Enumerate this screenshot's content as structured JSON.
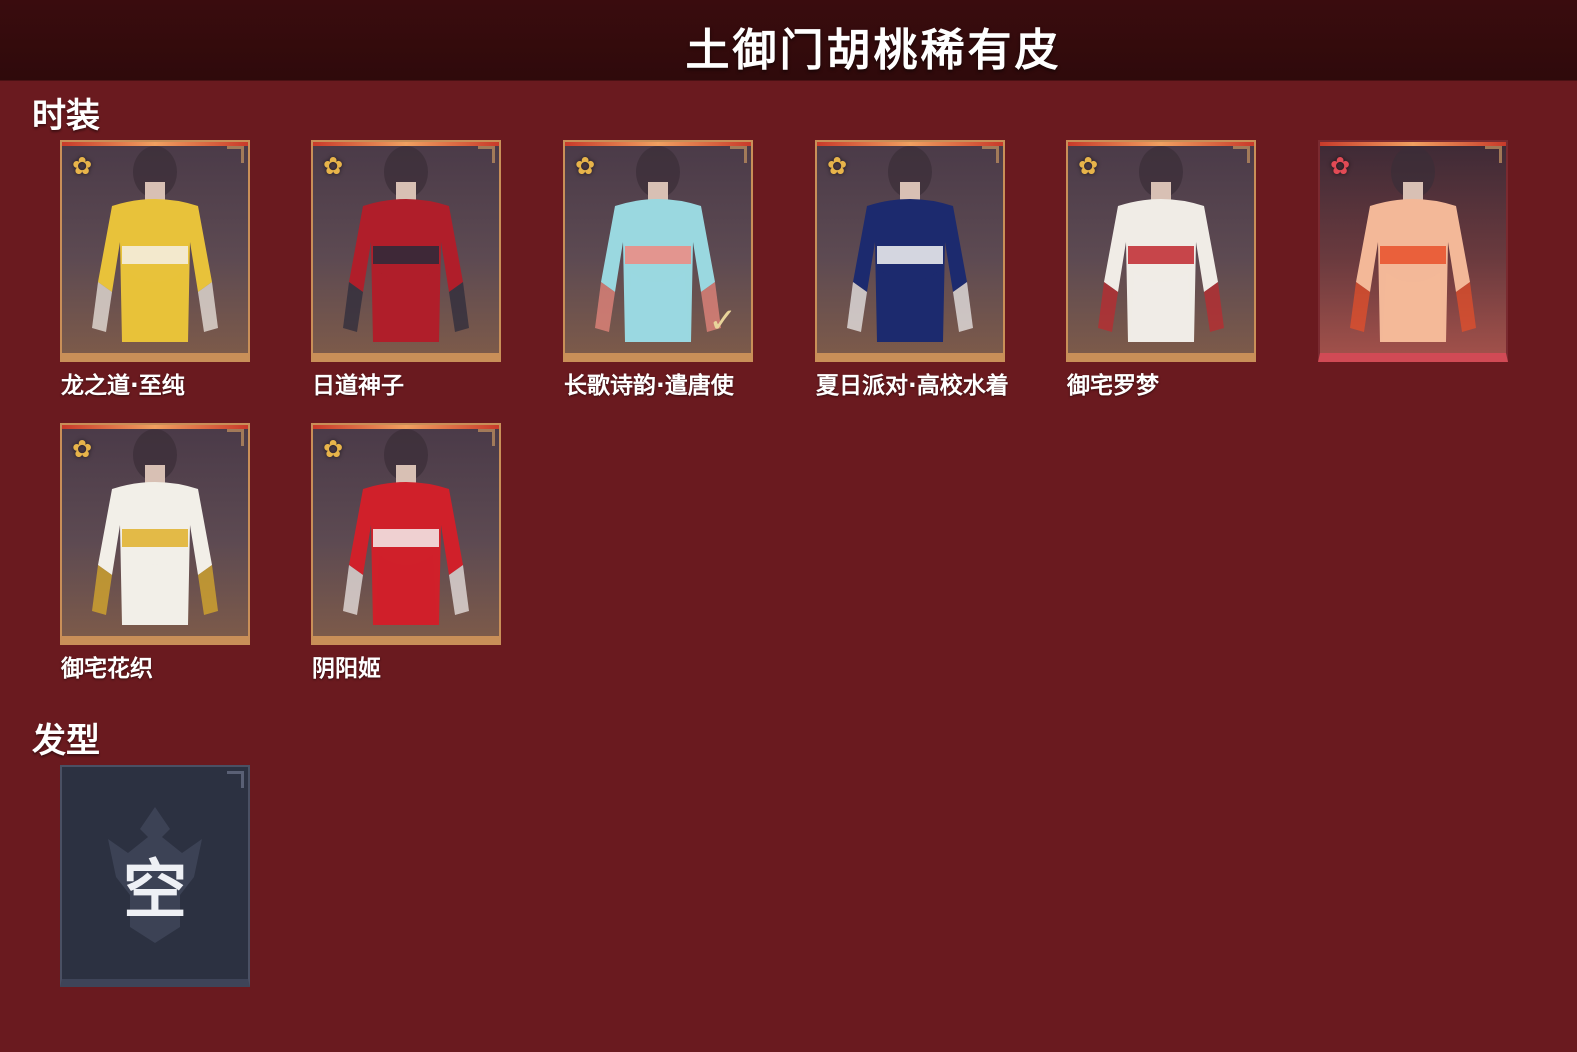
{
  "header": {
    "title": "土御门胡桃稀有皮"
  },
  "sections": {
    "fashion": {
      "title": "时装",
      "items": [
        {
          "name": "龙之道·至纯",
          "rarity_icon": "gold-flower-icon",
          "main_color": "#e8c23a",
          "accent_color": "#f4f0e8"
        },
        {
          "name": "日道神子",
          "rarity_icon": "gold-flower-icon",
          "main_color": "#b01e2a",
          "accent_color": "#2a2a3a"
        },
        {
          "name": "长歌诗韵·遣唐使",
          "rarity_icon": "gold-flower-icon",
          "main_color": "#9ad8e0",
          "accent_color": "#f08a80",
          "selected": true
        },
        {
          "name": "夏日派对·高校水着",
          "rarity_icon": "gold-flower-icon",
          "main_color": "#1c2a6e",
          "accent_color": "#f4f4f4"
        },
        {
          "name": "御宅罗梦",
          "rarity_icon": "gold-flower-icon",
          "main_color": "#f0ece6",
          "accent_color": "#c0282e"
        },
        {
          "name": "",
          "rarity_icon": "red-flower-icon",
          "main_color": "#f3b898",
          "accent_color": "#e8502a"
        },
        {
          "name": "御宅花织",
          "rarity_icon": "gold-flower-icon",
          "main_color": "#f2efe8",
          "accent_color": "#e0b02a"
        },
        {
          "name": "阴阳姬",
          "rarity_icon": "gold-flower-icon",
          "main_color": "#d0202a",
          "accent_color": "#f4f0ee"
        }
      ]
    },
    "hairstyle": {
      "title": "发型",
      "empty_text": "空"
    }
  },
  "icons": {
    "rarity": "✿",
    "selected_check": "✓"
  },
  "colors": {
    "background": "#6a1a1f",
    "header": "#2f0a0b",
    "gold_frame": "#d9a35c",
    "red_frame": "#d14a55"
  }
}
